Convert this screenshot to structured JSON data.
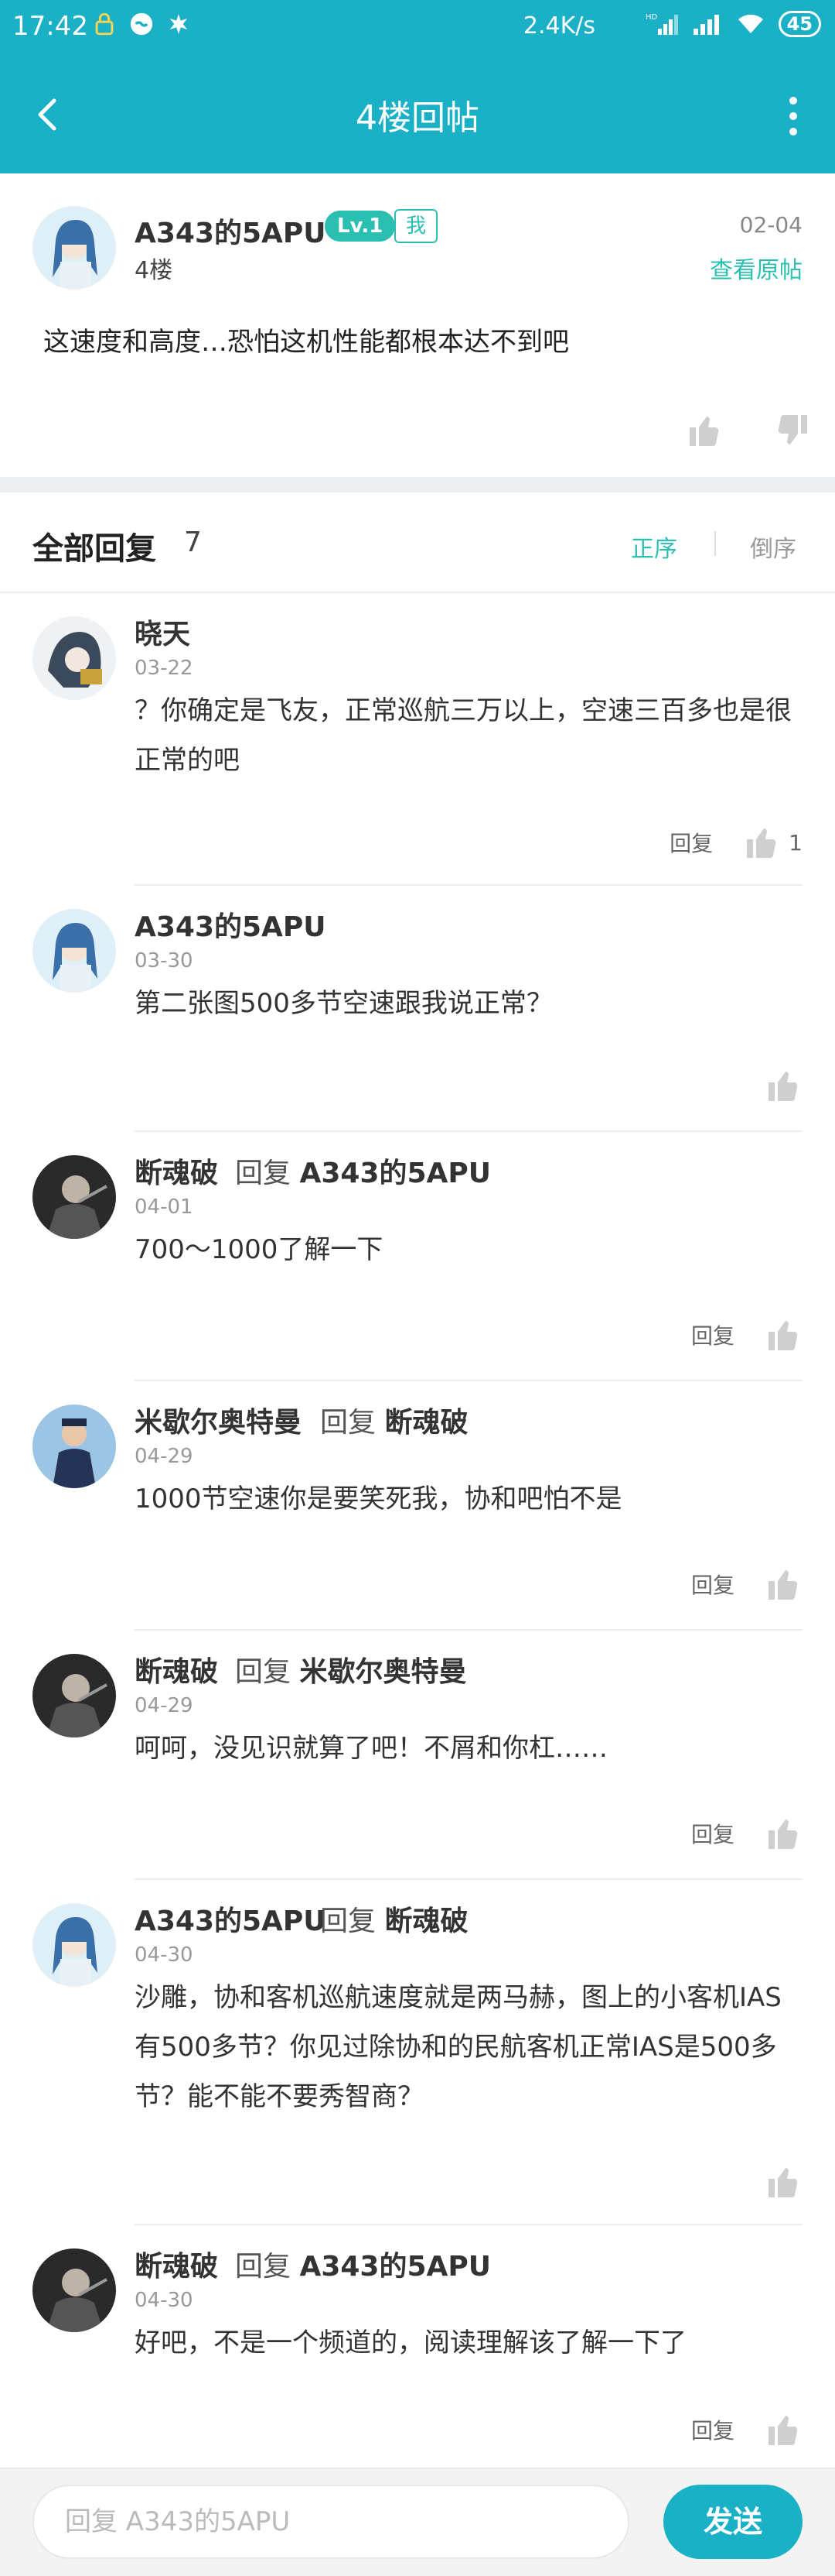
{
  "status_bar": {
    "time": "17:42",
    "speed": "2.4K/s",
    "battery": "45",
    "icons": [
      "lock-icon",
      "vpn-icon",
      "leaf-icon",
      "hd-signal-icon",
      "signal-icon",
      "wifi-icon",
      "battery-icon"
    ]
  },
  "header": {
    "title": "4楼回帖",
    "back_icon": "chevron-left-icon",
    "more_icon": "more-vertical-icon",
    "color": "#1ab1c6"
  },
  "post": {
    "username": "A343的5APU",
    "level": "Lv.1",
    "me_badge": "我",
    "floor": "4楼",
    "date": "02-04",
    "view_original": "查看原帖",
    "content": "这速度和高度…恐怕这机性能都根本达不到吧"
  },
  "replies_header": {
    "label": "全部回复",
    "count": "7",
    "asc": "正序",
    "desc": "倒序"
  },
  "replies": [
    {
      "user": "晓天",
      "reply_word": "",
      "reply_to": "",
      "date": "03-22",
      "text": "？你确定是飞友，正常巡航三万以上，空速三百多也是很正常的吧",
      "reply_label": "回复",
      "likes": "1"
    },
    {
      "user": "A343的5APU",
      "reply_word": "",
      "reply_to": "",
      "date": "03-30",
      "text": "第二张图500多节空速跟我说正常？",
      "reply_label": "",
      "likes": ""
    },
    {
      "user": "断魂破",
      "reply_word": "回复",
      "reply_to": "A343的5APU",
      "date": "04-01",
      "text": "700～1000了解一下",
      "reply_label": "回复",
      "likes": ""
    },
    {
      "user": "米歇尔奥特曼",
      "reply_word": "回复",
      "reply_to": "断魂破",
      "date": "04-29",
      "text": "1000节空速你是要笑死我，协和吧怕不是",
      "reply_label": "回复",
      "likes": ""
    },
    {
      "user": "断魂破",
      "reply_word": "回复",
      "reply_to": "米歇尔奥特曼",
      "date": "04-29",
      "text": "呵呵，没见识就算了吧！不屑和你杠……",
      "reply_label": "回复",
      "likes": ""
    },
    {
      "user": "A343的5APU",
      "reply_word": "回复",
      "reply_to": "断魂破",
      "date": "04-30",
      "text": "沙雕，协和客机巡航速度就是两马赫，图上的小客机IAS有500多节？你见过除协和的民航客机正常IAS是500多节？能不能不要秀智商？",
      "reply_label": "",
      "likes": ""
    },
    {
      "user": "断魂破",
      "reply_word": "回复",
      "reply_to": "A343的5APU",
      "date": "04-30",
      "text": "好吧，不是一个频道的，阅读理解该了解一下了",
      "reply_label": "回复",
      "likes": ""
    }
  ],
  "bottom": {
    "placeholder": "回复 A343的5APU",
    "send": "发送"
  }
}
